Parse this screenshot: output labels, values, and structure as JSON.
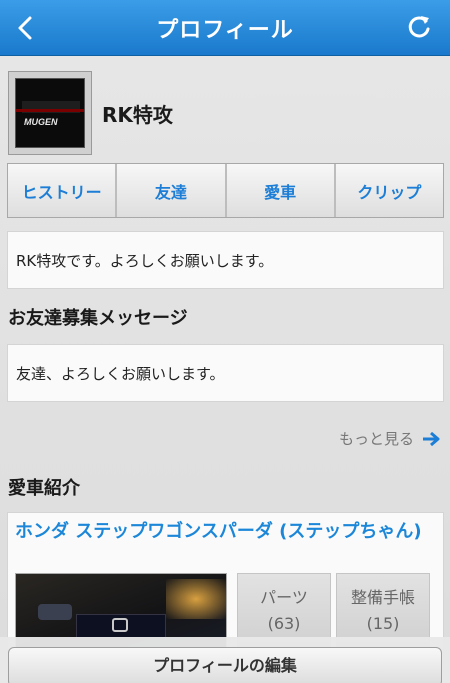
{
  "header": {
    "title": "プロフィール",
    "back_icon": "chevron-left-icon",
    "refresh_icon": "refresh-icon"
  },
  "profile": {
    "username": "RK特攻",
    "avatar_logo_text": "MUGEN"
  },
  "tabs": [
    {
      "label": "ヒストリー"
    },
    {
      "label": "友達"
    },
    {
      "label": "愛車"
    },
    {
      "label": "クリップ"
    }
  ],
  "intro": {
    "text": "RK特攻です。よろしくお願いします。"
  },
  "friend_section": {
    "title": "お友達募集メッセージ",
    "message": "友達、よろしくお願いします。",
    "more_label": "もっと見る"
  },
  "car_section": {
    "title": "愛車紹介",
    "car_name": "ホンダ ステップワゴンスパーダ (ステップちゃん)",
    "parts_label": "パーツ",
    "parts_count": "(63)",
    "maintenance_label": "整備手帳",
    "maintenance_count": "(15)"
  },
  "footer": {
    "edit_button": "プロフィールの編集"
  },
  "colors": {
    "nav_blue": "#1a79cc",
    "link_blue": "#1c7ed6"
  }
}
